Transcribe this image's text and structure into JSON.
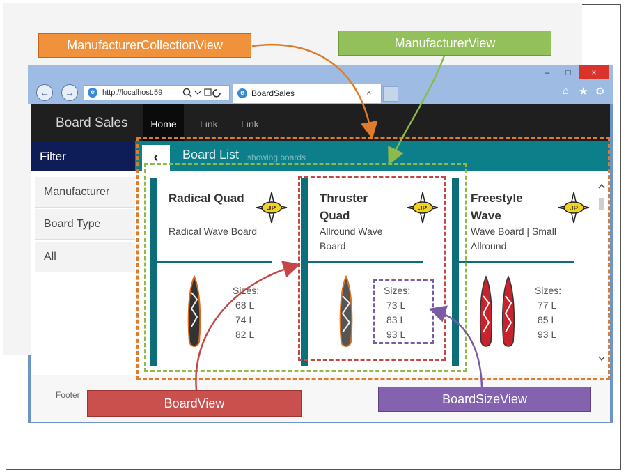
{
  "labels": {
    "manufacturer_collection_view": "ManufacturerCollectionView",
    "manufacturer_view": "ManufacturerView",
    "board_view": "BoardView",
    "board_size_view": "BoardSizeView"
  },
  "browser": {
    "address": "http://localhost:59",
    "tab_title": "BoardSales",
    "tab_close": "×",
    "back": "←",
    "forward": "→",
    "minimize": "–",
    "maximize": "□",
    "close": "×"
  },
  "app": {
    "brand": "Board Sales",
    "nav": [
      "Home",
      "Link",
      "Link"
    ],
    "filter_title": "Filter",
    "filter_items": [
      "Manufacturer",
      "Board Type",
      "All"
    ],
    "list_title": "Board List",
    "list_subtitle": "showing boards",
    "back_glyph": "‹",
    "footer": "Footer"
  },
  "boards": [
    {
      "name": "Radical Quad",
      "type": "Radical Wave Board",
      "sizes_label": "Sizes:",
      "sizes": [
        "68 L",
        "74 L",
        "82 L"
      ]
    },
    {
      "name": "Thruster Quad",
      "type": "Allround Wave Board",
      "sizes_label": "Sizes:",
      "sizes": [
        "73 L",
        "83 L",
        "93 L"
      ]
    },
    {
      "name": "Freestyle Wave",
      "type": "Wave Board | Small Allround",
      "sizes_label": "Sizes:",
      "sizes": [
        "77 L",
        "85 L",
        "93 L"
      ]
    }
  ],
  "colors": {
    "manufacturer_collection_view": "#e07b2a",
    "manufacturer_view": "#8dba4a",
    "board_view": "#c64646",
    "board_size_view": "#7a5ba8"
  }
}
